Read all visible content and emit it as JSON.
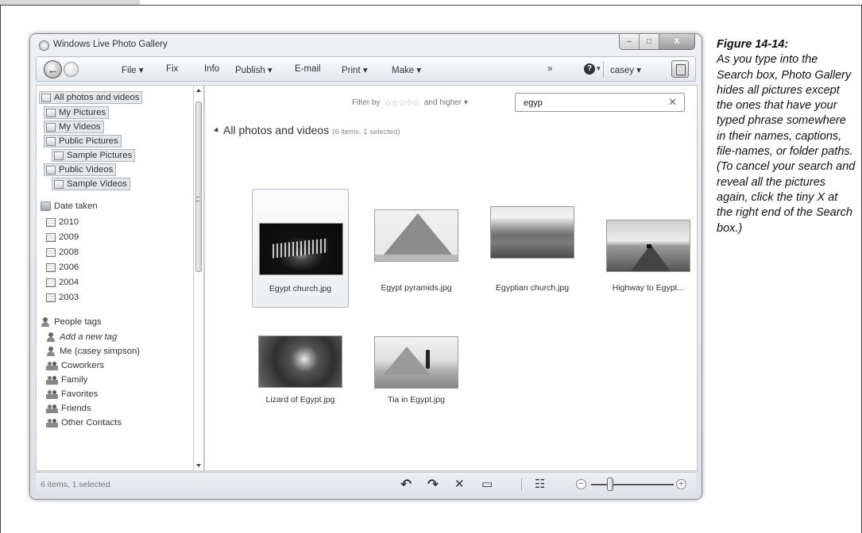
{
  "window": {
    "title": "Windows Live Photo Gallery",
    "minimize_glyph": "–",
    "maximize_glyph": "□",
    "close_glyph": "X"
  },
  "toolbar": {
    "back_glyph": "←",
    "file": "File ▾",
    "fix": "Fix",
    "info": "Info",
    "publish": "Publish ▾",
    "email": "E-mail",
    "print": "Print ▾",
    "make": "Make ▾",
    "overflow": "»",
    "help": "? ▾",
    "user": "casey ▾"
  },
  "nav": {
    "all_photos": "All photos and videos",
    "my_pictures": "My Pictures",
    "my_videos": "My Videos",
    "public_pictures": "Public Pictures",
    "sample_pictures": "Sample Pictures",
    "public_videos": "Public Videos",
    "sample_videos": "Sample Videos",
    "date_taken": "Date taken",
    "years": [
      "2010",
      "2009",
      "2008",
      "2006",
      "2004",
      "2003"
    ],
    "people_tags": "People tags",
    "add_tag": "Add a new tag",
    "me": "Me (casey simpson)",
    "tags": [
      "Coworkers",
      "Family",
      "Favorites",
      "Friends",
      "Other Contacts"
    ]
  },
  "main": {
    "filter_label": "Filter by",
    "stars": "☆☆☆☆☆",
    "filter_suffix": "and higher ▾",
    "search_value": "egyp",
    "search_clear": "✕",
    "group_title": "All photos and videos",
    "group_count": "(6 items, 1 selected)",
    "photos": [
      "Egypt church.jpg",
      "Egypt pyramids.jpg",
      "Egyptian church.jpg",
      "Highway to Egypt...",
      "Lizard of Egypt.jpg",
      "Tia in Egypt.jpg"
    ]
  },
  "status": {
    "text": "6 items, 1 selected",
    "rotate_left": "↶",
    "rotate_right": "↷",
    "delete": "✕",
    "slideshow": "▭",
    "details": "☷",
    "zoom_out": "−",
    "zoom_in": "+"
  },
  "figure": {
    "number": "Figure 14-14:",
    "text": "As you type into the Search box, Photo Gallery hides all pictures except the ones that have your typed phrase somewhere in their names, captions, file-names, or folder paths. (To cancel your search and reveal all the pictures again, click the tiny X at the right end of the Search box.)"
  }
}
